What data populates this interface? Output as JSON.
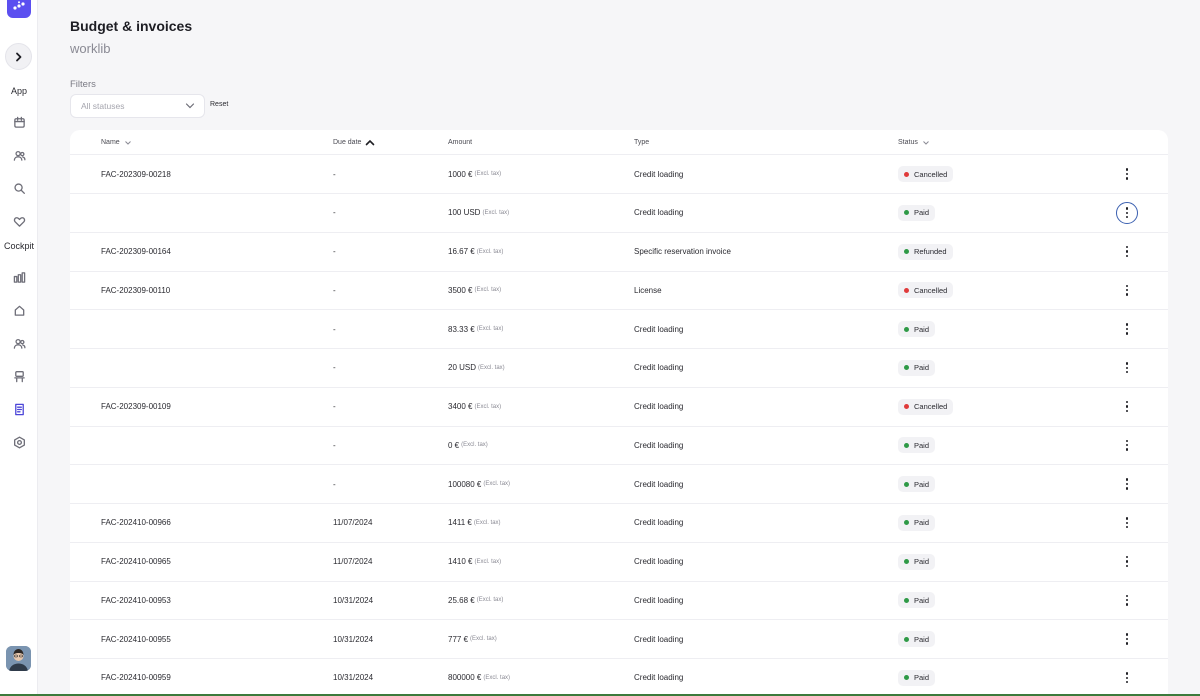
{
  "page": {
    "title": "Budget & invoices",
    "subtitle": "worklib"
  },
  "sidebar": {
    "sections": {
      "app": "App",
      "cockpit": "Cockpit"
    },
    "icons": {
      "logo": "app-logo-icon",
      "toggle": "chevron-right-icon",
      "app": [
        "calendar-icon",
        "users-icon",
        "search-icon",
        "heart-icon"
      ],
      "cockpit": [
        "bar-chart-icon",
        "home-icon",
        "team-icon",
        "desk-icon",
        "invoice-icon",
        "settings-icon"
      ]
    },
    "active": "invoice-icon"
  },
  "filters": {
    "label": "Filters",
    "status_placeholder": "All statuses",
    "reset_label": "Reset"
  },
  "table": {
    "columns": {
      "name": "Name",
      "due": "Due date",
      "amount": "Amount",
      "type": "Type",
      "status": "Status"
    },
    "tax_suffix": "(Excl. tax)",
    "rows": [
      {
        "name": "FAC-202309-00218",
        "due": "-",
        "amount": "1000 €",
        "type": "Credit loading",
        "status": "Cancelled"
      },
      {
        "name": "",
        "due": "-",
        "amount": "100 USD",
        "type": "Credit loading",
        "status": "Paid"
      },
      {
        "name": "FAC-202309-00164",
        "due": "-",
        "amount": "16.67 €",
        "type": "Specific reservation invoice",
        "status": "Refunded"
      },
      {
        "name": "FAC-202309-00110",
        "due": "-",
        "amount": "3500 €",
        "type": "License",
        "status": "Cancelled"
      },
      {
        "name": "",
        "due": "-",
        "amount": "83.33 €",
        "type": "Credit loading",
        "status": "Paid"
      },
      {
        "name": "",
        "due": "-",
        "amount": "20 USD",
        "type": "Credit loading",
        "status": "Paid"
      },
      {
        "name": "FAC-202309-00109",
        "due": "-",
        "amount": "3400 €",
        "type": "Credit loading",
        "status": "Cancelled"
      },
      {
        "name": "",
        "due": "-",
        "amount": "0 €",
        "type": "Credit loading",
        "status": "Paid"
      },
      {
        "name": "",
        "due": "-",
        "amount": "100080 €",
        "type": "Credit loading",
        "status": "Paid"
      },
      {
        "name": "FAC-202410-00966",
        "due": "11/07/2024",
        "amount": "1411 €",
        "type": "Credit loading",
        "status": "Paid"
      },
      {
        "name": "FAC-202410-00965",
        "due": "11/07/2024",
        "amount": "1410 €",
        "type": "Credit loading",
        "status": "Paid"
      },
      {
        "name": "FAC-202410-00953",
        "due": "10/31/2024",
        "amount": "25.68 €",
        "type": "Credit loading",
        "status": "Paid"
      },
      {
        "name": "FAC-202410-00955",
        "due": "10/31/2024",
        "amount": "777 €",
        "type": "Credit loading",
        "status": "Paid"
      },
      {
        "name": "FAC-202410-00959",
        "due": "10/31/2024",
        "amount": "800000 €",
        "type": "Credit loading",
        "status": "Paid"
      }
    ]
  },
  "status_colors": {
    "Cancelled": "#e03b3b",
    "Paid": "#2f9a47",
    "Refunded": "#2f9a47"
  },
  "accent": "#5b4ff0"
}
